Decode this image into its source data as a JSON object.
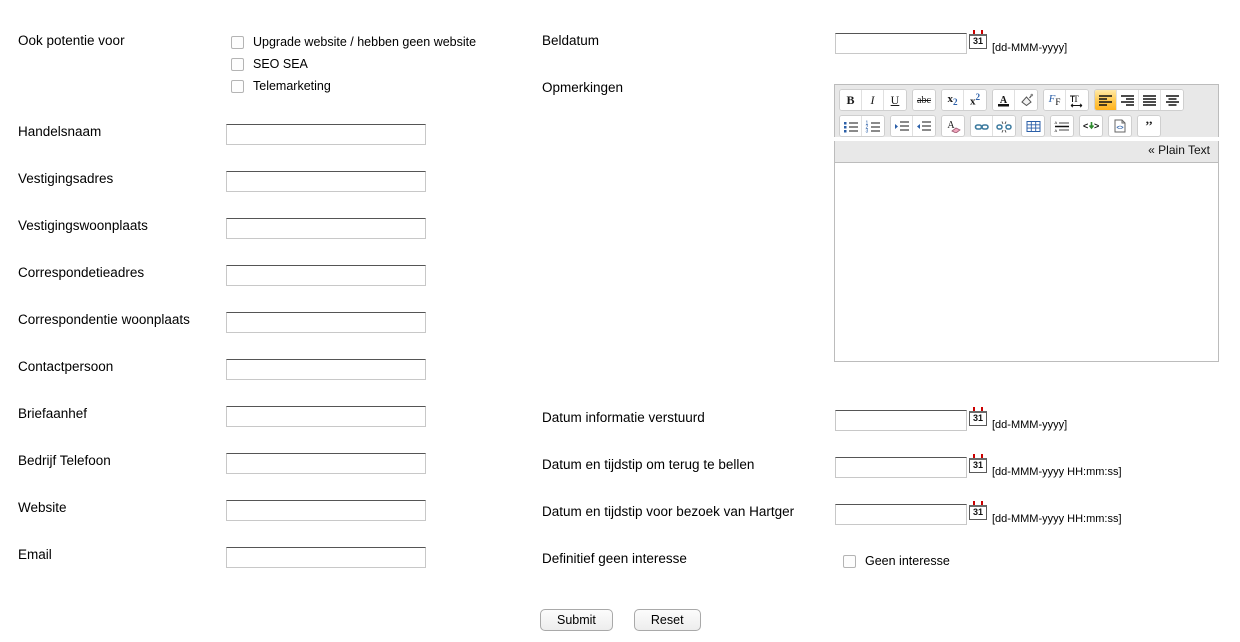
{
  "left_column": {
    "potential_group": {
      "label": "Ook potentie voor",
      "options": [
        "Upgrade website / hebben geen website",
        "SEO SEA",
        "Telemarketing"
      ]
    },
    "fields": [
      {
        "label": "Handelsnaam",
        "value": ""
      },
      {
        "label": "Vestigingsadres",
        "value": ""
      },
      {
        "label": "Vestigingswoonplaats",
        "value": ""
      },
      {
        "label": "Correspondetieadres",
        "value": ""
      },
      {
        "label": "Correspondentie woonplaats",
        "value": ""
      },
      {
        "label": "Contactpersoon",
        "value": ""
      },
      {
        "label": "Briefaanhef",
        "value": ""
      },
      {
        "label": "Bedrijf Telefoon",
        "value": ""
      },
      {
        "label": "Website",
        "value": ""
      },
      {
        "label": "Email",
        "value": ""
      }
    ]
  },
  "right_column": {
    "beldatum": {
      "label": "Beldatum",
      "value": "",
      "format_hint": "[dd-MMM-yyyy]",
      "icon": "calendar-icon",
      "icon_day": "31"
    },
    "opmerkingen": {
      "label": "Opmerkingen",
      "plain_text_link": "« Plain Text",
      "content": "",
      "toolbar_row1": [
        {
          "name": "bold-button",
          "glyph": "B",
          "active": false
        },
        {
          "name": "italic-button",
          "glyph": "I",
          "active": false
        },
        {
          "name": "underline-button",
          "glyph": "U",
          "active": false
        },
        {
          "name": "strikethrough-button",
          "glyph": "abc",
          "active": false
        },
        {
          "name": "subscript-button",
          "glyph": "x₂",
          "active": false
        },
        {
          "name": "superscript-button",
          "glyph": "x²",
          "active": false
        },
        {
          "name": "text-color-button",
          "glyph": "A",
          "active": false
        },
        {
          "name": "background-color-button",
          "glyph": "fill",
          "active": false
        },
        {
          "name": "font-button",
          "glyph": "F",
          "active": false
        },
        {
          "name": "font-size-button",
          "glyph": "T",
          "active": false
        },
        {
          "name": "align-left-button",
          "glyph": "align-left",
          "active": true
        },
        {
          "name": "align-right-button",
          "glyph": "align-right",
          "active": false
        },
        {
          "name": "align-justify-button",
          "glyph": "align-justify",
          "active": false
        },
        {
          "name": "align-center-button",
          "glyph": "align-center",
          "active": false
        }
      ],
      "toolbar_row2": [
        {
          "name": "bullet-list-button",
          "glyph": "ul"
        },
        {
          "name": "numbered-list-button",
          "glyph": "ol"
        },
        {
          "name": "indent-increase-button",
          "glyph": "indent"
        },
        {
          "name": "indent-decrease-button",
          "glyph": "outdent"
        },
        {
          "name": "remove-format-button",
          "glyph": "eraser"
        },
        {
          "name": "insert-link-button",
          "glyph": "link"
        },
        {
          "name": "unlink-button",
          "glyph": "unlink"
        },
        {
          "name": "insert-table-button",
          "glyph": "table"
        },
        {
          "name": "horizontal-rule-button",
          "glyph": "hr"
        },
        {
          "name": "special-char-button",
          "glyph": "<>"
        },
        {
          "name": "source-code-button",
          "glyph": "source"
        },
        {
          "name": "blockquote-button",
          "glyph": "quote"
        }
      ]
    },
    "date_fields": [
      {
        "label": "Datum informatie verstuurd",
        "value": "",
        "format_hint": "[dd-MMM-yyyy]",
        "icon_day": "31"
      },
      {
        "label": "Datum en tijdstip om terug te bellen",
        "value": "",
        "format_hint": "[dd-MMM-yyyy HH:mm:ss]",
        "icon_day": "31"
      },
      {
        "label": "Datum en tijdstip voor bezoek van Hartger",
        "value": "",
        "format_hint": "[dd-MMM-yyyy HH:mm:ss]",
        "icon_day": "31"
      }
    ],
    "no_interest": {
      "label": "Definitief geen interesse",
      "checkbox_label": "Geen interesse"
    }
  },
  "actions": {
    "submit_label": "Submit",
    "reset_label": "Reset"
  },
  "colors": {
    "active_toolbar": "#ffc84d",
    "toolbar_bg": "#e8e8e8",
    "input_border_top": "#555555"
  }
}
